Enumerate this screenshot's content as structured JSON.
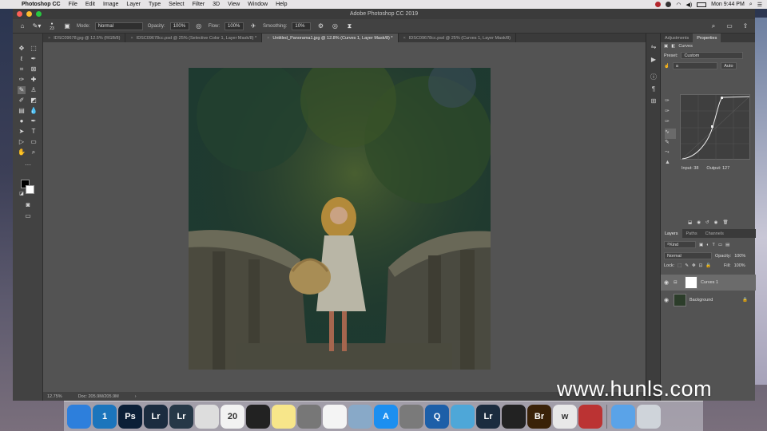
{
  "menubar": {
    "app_name": "Photoshop CC",
    "menus": [
      "File",
      "Edit",
      "Image",
      "Layer",
      "Type",
      "Select",
      "Filter",
      "3D",
      "View",
      "Window",
      "Help"
    ],
    "clock": "Mon 9:44 PM"
  },
  "window": {
    "title": "Adobe Photoshop CC 2019"
  },
  "options_bar": {
    "brush_size": "23",
    "mode_label": "Mode:",
    "mode_value": "Normal",
    "opacity_label": "Opacity:",
    "opacity_value": "100%",
    "flow_label": "Flow:",
    "flow_value": "100%",
    "smoothing_label": "Smoothing:",
    "smoothing_value": "10%"
  },
  "tabs": [
    {
      "label": "IDSC09678.jpg @ 12.5% (RGB/8)",
      "active": false
    },
    {
      "label": "IDSC09678cc.psd @ 25% (Selective Color 1, Layer Mask/8) *",
      "active": false
    },
    {
      "label": "Untitled_Panorama1.jpg @ 12.8% (Curves 1, Layer Mask/8) *",
      "active": true
    },
    {
      "label": "IDSC09678cc.psd @ 25% (Curves 1, Layer Mask/8)",
      "active": false
    }
  ],
  "status_bar": {
    "zoom": "12.75%",
    "doc": "Doc: 205.9M/205.9M"
  },
  "panels": {
    "top_tabs": [
      "Adjustments",
      "Properties"
    ],
    "properties_title": "Curves",
    "preset_label": "Preset:",
    "preset_value": "Custom",
    "channel_value": "a",
    "auto_label": "Auto",
    "input_label": "Input: 38",
    "output_label": "Output: 127",
    "layer_tabs": [
      "Layers",
      "Paths",
      "Channels"
    ],
    "kind_label": "Kind",
    "blend_mode": "Normal",
    "opacity_label": "Opacity:",
    "opacity_value": "100%",
    "lock_label": "Lock:",
    "fill_label": "Fill:",
    "fill_value": "100%",
    "layers": [
      {
        "name": "Curves 1",
        "selected": true
      },
      {
        "name": "Background",
        "selected": false
      }
    ]
  },
  "dock": {
    "apps": [
      {
        "name": "Finder",
        "glyph": "",
        "color": "#2d7fdc"
      },
      {
        "name": "1Password",
        "glyph": "1",
        "color": "#1b75bc"
      },
      {
        "name": "Photoshop",
        "glyph": "Ps",
        "color": "#0b1f37"
      },
      {
        "name": "Lightroom Classic",
        "glyph": "Lr",
        "color": "#1b2c3f"
      },
      {
        "name": "Lightroom",
        "glyph": "Lr",
        "color": "#263847"
      },
      {
        "name": "Chrome",
        "glyph": "",
        "color": "#ddd"
      },
      {
        "name": "Calendar",
        "glyph": "20",
        "color": "#f2f2f2"
      },
      {
        "name": "Final Cut",
        "glyph": "",
        "color": "#222"
      },
      {
        "name": "Notes",
        "glyph": "",
        "color": "#f7e68a"
      },
      {
        "name": "Screenshot",
        "glyph": "",
        "color": "#777"
      },
      {
        "name": "Reminders",
        "glyph": "",
        "color": "#f4f4f4"
      },
      {
        "name": "Preview",
        "glyph": "",
        "color": "#88a9c8"
      },
      {
        "name": "App Store",
        "glyph": "A",
        "color": "#1c8ff0"
      },
      {
        "name": "System Preferences",
        "glyph": "",
        "color": "#7a7a7a"
      },
      {
        "name": "QuickTime",
        "glyph": "Q",
        "color": "#1d5fa8"
      },
      {
        "name": "Image Capture",
        "glyph": "",
        "color": "#4ea7d8"
      },
      {
        "name": "Lightroom Classic 2",
        "glyph": "Lr",
        "color": "#1b2c3f"
      },
      {
        "name": "OBS",
        "glyph": "",
        "color": "#222"
      },
      {
        "name": "Bridge",
        "glyph": "Br",
        "color": "#3a2208"
      },
      {
        "name": "Wunderlist",
        "glyph": "w",
        "color": "#e8e8e8"
      },
      {
        "name": "Toolbox",
        "glyph": "",
        "color": "#b33"
      },
      {
        "name": "Downloads",
        "glyph": "",
        "color": "#5aa3e8"
      },
      {
        "name": "Trash",
        "glyph": "",
        "color": "#cfd4da"
      }
    ]
  },
  "watermark": "www.hunls.com"
}
